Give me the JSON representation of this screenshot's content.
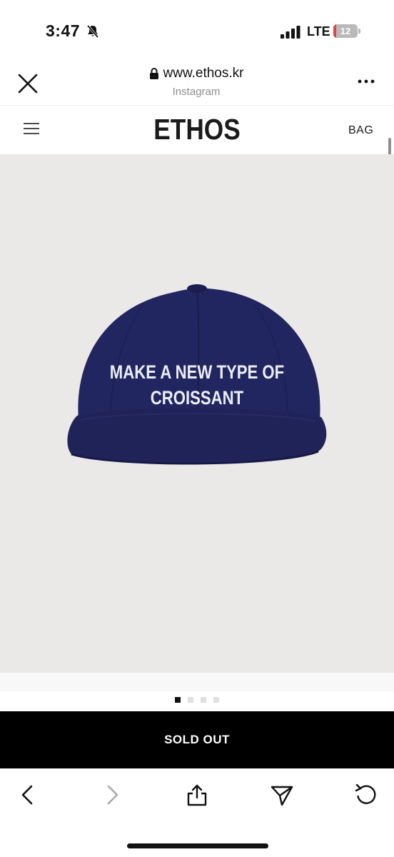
{
  "status_bar": {
    "time": "3:47",
    "network": "LTE",
    "battery_level": "12",
    "battery_fraction": 0.12,
    "battery_color": "#e0443a",
    "icons": [
      "bell-slash-icon",
      "signal-icon",
      "battery-icon"
    ]
  },
  "browser": {
    "url": "www.ethos.kr",
    "source": "Instagram",
    "icons": [
      "close-icon",
      "lock-icon",
      "more-icon"
    ]
  },
  "site_nav": {
    "logo": "ETHOS",
    "bag_label": "BAG",
    "icons": [
      "hamburger-menu-icon"
    ]
  },
  "product": {
    "embroidery_line_1": "MAKE A NEW TYPE OF",
    "embroidery_line_2": "CROISSANT",
    "cap_color": "#1f2358",
    "background_color": "#eae9e8"
  },
  "pagination": {
    "total": 4,
    "current": 1
  },
  "cta": {
    "label": "SOLD OUT"
  },
  "toolbar": {
    "icons": [
      "back-icon",
      "forward-icon",
      "share-icon",
      "send-icon",
      "reload-icon"
    ]
  }
}
